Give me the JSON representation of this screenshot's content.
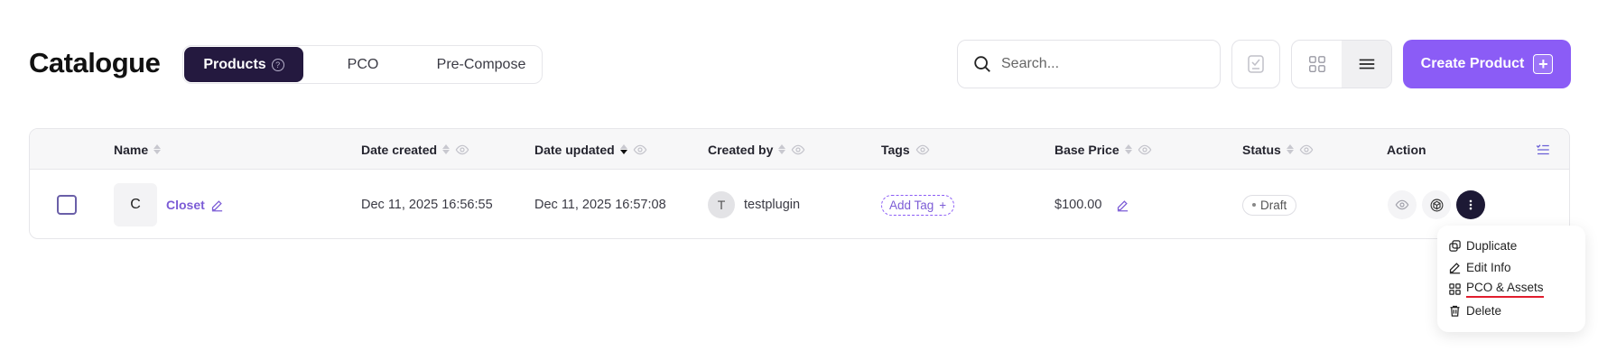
{
  "header": {
    "title": "Catalogue",
    "tabs": [
      {
        "label": "Products",
        "active": true
      },
      {
        "label": "PCO",
        "active": false
      },
      {
        "label": "Pre-Compose",
        "active": false
      }
    ],
    "search_placeholder": "Search...",
    "create_button_label": "Create Product"
  },
  "table": {
    "columns": {
      "name": "Name",
      "date_created": "Date created",
      "date_updated": "Date updated",
      "created_by": "Created by",
      "tags": "Tags",
      "base_price": "Base Price",
      "status": "Status",
      "action": "Action"
    },
    "rows": [
      {
        "thumb_letter": "C",
        "name": "Closet",
        "date_created": "Dec 11, 2025 16:56:55",
        "date_updated": "Dec 11, 2025 16:57:08",
        "creator_initial": "T",
        "creator": "testplugin",
        "add_tag_label": "Add Tag",
        "base_price": "$100.00",
        "status": "Draft"
      }
    ]
  },
  "action_menu": {
    "items": [
      "Duplicate",
      "Edit Info",
      "PCO & Assets",
      "Delete"
    ]
  },
  "colors": {
    "accent": "#8b5cf6",
    "active_tab": "#24193f",
    "highlight_underline": "#e11d2e"
  }
}
